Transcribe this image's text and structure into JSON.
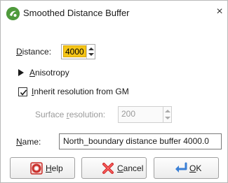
{
  "window": {
    "title": "Smoothed Distance Buffer",
    "app_icon": "leapfrog-app-icon",
    "close_glyph": "×"
  },
  "distance": {
    "label": "Distance:",
    "value": "4000"
  },
  "anisotropy": {
    "label": "Anisotropy",
    "expanded": false
  },
  "inherit": {
    "label": "Inherit resolution from GM",
    "checked": true
  },
  "surface_resolution": {
    "label": "Surface resolution:",
    "value": "200",
    "enabled": false
  },
  "name": {
    "label": "Name:",
    "value": "North_boundary distance buffer 4000.0"
  },
  "buttons": {
    "help": "Help",
    "cancel": "Cancel",
    "ok": "OK"
  },
  "colors": {
    "accent_highlight": "#f5c518",
    "help_icon": "#d9534f",
    "cancel_icon": "#d22b2b",
    "ok_icon": "#3a7fd5"
  }
}
